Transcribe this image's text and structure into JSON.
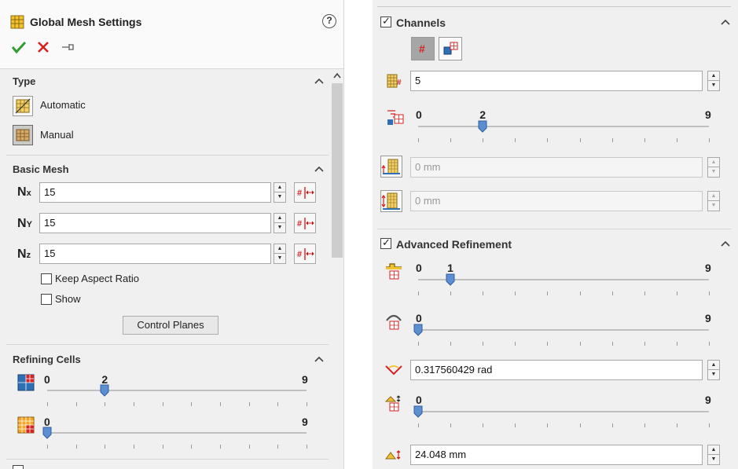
{
  "left": {
    "title": "Global Mesh Settings",
    "help": "?",
    "type": {
      "title": "Type",
      "automatic": "Automatic",
      "manual": "Manual"
    },
    "basic": {
      "title": "Basic Mesh",
      "nx_value": "15",
      "ny_value": "15",
      "nz_value": "15",
      "keep_aspect": "Keep Aspect Ratio",
      "show": "Show",
      "control_planes": "Control Planes"
    },
    "refining": {
      "title": "Refining Cells",
      "s1_min": "0",
      "s1_val": "2",
      "s1_max": "9",
      "s1_value": 2,
      "s1_range": [
        0,
        9
      ],
      "s2_min": "0",
      "s2_max": "9",
      "s2_value": 0,
      "s2_range": [
        0,
        9
      ]
    }
  },
  "right": {
    "channels": {
      "title": "Channels",
      "count_value": "5",
      "s_min": "0",
      "s_val": "2",
      "s_max": "9",
      "s_value": 2,
      "s_range": [
        0,
        9
      ],
      "min_height": "0 mm",
      "max_height": "0 mm"
    },
    "advanced": {
      "title": "Advanced Refinement",
      "s1_min": "0",
      "s1_val": "1",
      "s1_max": "9",
      "s1_value": 1,
      "s1_range": [
        0,
        9
      ],
      "s2_min": "0",
      "s2_max": "9",
      "s2_value": 0,
      "s2_range": [
        0,
        9
      ],
      "angle_value": "0.317560429 rad",
      "s3_min": "0",
      "s3_max": "9",
      "s3_value": 0,
      "s3_range": [
        0,
        9
      ],
      "gap_value": "24.048 mm"
    }
  },
  "colors": {
    "accent_green": "#2e9e2e",
    "accent_red": "#d62222",
    "thumb_blue": "#5b8fd1"
  }
}
